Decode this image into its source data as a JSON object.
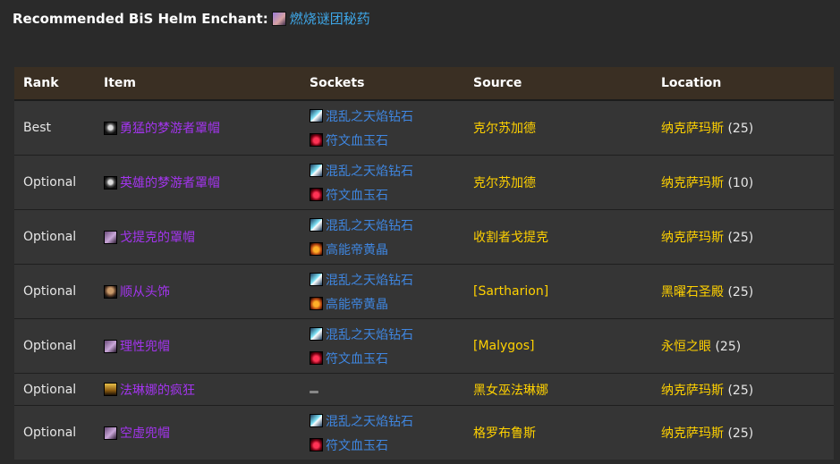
{
  "header": {
    "label": "Recommended BiS Helm Enchant:",
    "enchant_icon": "enchant-potion-icon",
    "enchant_name": "燃烧谜团秘药"
  },
  "table": {
    "columns": [
      "Rank",
      "Item",
      "Sockets",
      "Source",
      "Location"
    ],
    "rows": [
      {
        "rank": "Best",
        "item": "勇猛的梦游者罩帽",
        "item_icon": "helm-icon",
        "sockets": [
          "混乱之天焰钻石",
          "符文血玉石"
        ],
        "socket_icons": [
          "diamond-gem-icon",
          "ruby-gem-icon"
        ],
        "source": "克尔苏加德",
        "location": "纳克萨玛斯",
        "level": "(25)"
      },
      {
        "rank": "Optional",
        "item": "英雄的梦游者罩帽",
        "item_icon": "helm-icon",
        "sockets": [
          "混乱之天焰钻石",
          "符文血玉石"
        ],
        "socket_icons": [
          "diamond-gem-icon",
          "ruby-gem-icon"
        ],
        "source": "克尔苏加德",
        "location": "纳克萨玛斯",
        "level": "(10)"
      },
      {
        "rank": "Optional",
        "item": "戈提克的罩帽",
        "item_icon": "hood-icon",
        "sockets": [
          "混乱之天焰钻石",
          "高能帝黄晶"
        ],
        "socket_icons": [
          "diamond-gem-icon",
          "topaz-gem-icon"
        ],
        "source": "收割者戈提克",
        "location": "纳克萨玛斯",
        "level": "(25)"
      },
      {
        "rank": "Optional",
        "item": "顺从头饰",
        "item_icon": "mask-icon",
        "sockets": [
          "混乱之天焰钻石",
          "高能帝黄晶"
        ],
        "socket_icons": [
          "diamond-gem-icon",
          "topaz-gem-icon"
        ],
        "source": "[Sartharion]",
        "location": "黑曜石圣殿",
        "level": "(25)"
      },
      {
        "rank": "Optional",
        "item": "理性兜帽",
        "item_icon": "hood-icon",
        "sockets": [
          "混乱之天焰钻石",
          "符文血玉石"
        ],
        "socket_icons": [
          "diamond-gem-icon",
          "ruby-gem-icon"
        ],
        "source": "[Malygos]",
        "location": "永恒之眼",
        "level": "(25)"
      },
      {
        "rank": "Optional",
        "item": "法琳娜的疯狂",
        "item_icon": "crown-icon",
        "sockets": [],
        "socket_icons": [],
        "source": "黑女巫法琳娜",
        "location": "纳克萨玛斯",
        "level": "(25)"
      },
      {
        "rank": "Optional",
        "item": "空虚兜帽",
        "item_icon": "hood-icon",
        "sockets": [
          "混乱之天焰钻石",
          "符文血玉石"
        ],
        "socket_icons": [
          "diamond-gem-icon",
          "ruby-gem-icon"
        ],
        "source": "格罗布鲁斯",
        "location": "纳克萨玛斯",
        "level": "(25)"
      }
    ]
  },
  "colors": {
    "epic": "#a335ee",
    "gem_link": "#3f86e0",
    "source_gold": "#ffd100",
    "enchant_link": "#3ea7e8",
    "header_bg": "#3a2f23"
  }
}
